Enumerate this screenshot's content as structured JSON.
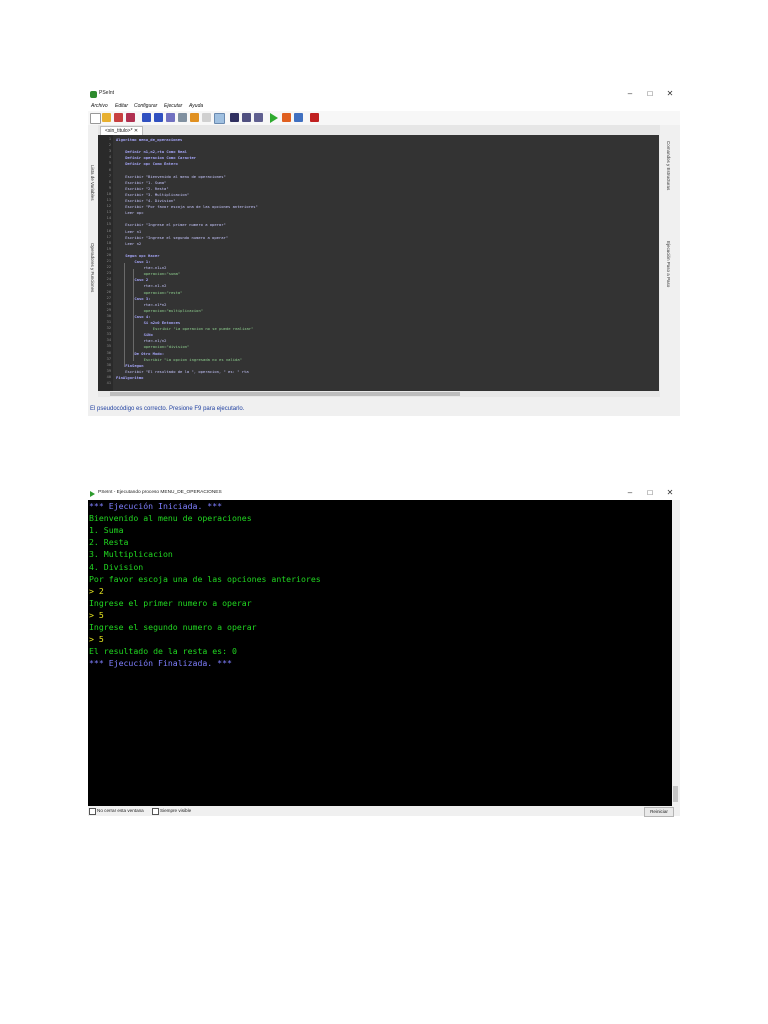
{
  "editor_window": {
    "title": "PSeInt",
    "controls": [
      "–",
      "□",
      "✕"
    ],
    "menu": [
      "Archivo",
      "Editar",
      "Configurar",
      "Ejecutar",
      "Ayuda"
    ],
    "left_panel_labels": [
      "Lista de Variables",
      "Operadores y Funciones"
    ],
    "right_panel_labels": [
      "Comandos y Estructuras",
      "Ejecución Paso a Paso"
    ],
    "tab_label": "<sin_titulo>*  ✕",
    "status": "El pseudocódigo es correcto. Presione F9 para ejecutarlo.",
    "accent_color": "#2e8b2e",
    "code_lines": [
      {
        "n": "1",
        "indent": 0,
        "type": "kw",
        "text": "Algoritmo menu_de_operaciones"
      },
      {
        "n": "2",
        "indent": 0,
        "type": "plain",
        "text": ""
      },
      {
        "n": "3",
        "indent": 2,
        "type": "kw",
        "text": "Definir n1,n2,rta Como Real"
      },
      {
        "n": "4",
        "indent": 2,
        "type": "kw",
        "text": "Definir operacion Como Caracter"
      },
      {
        "n": "5",
        "indent": 2,
        "type": "kw",
        "text": "Definir opc Como Entero"
      },
      {
        "n": "6",
        "indent": 0,
        "type": "plain",
        "text": ""
      },
      {
        "n": "7",
        "indent": 2,
        "type": "plain",
        "text": "Escribir \"Bienvenido al menu de operaciones\""
      },
      {
        "n": "8",
        "indent": 2,
        "type": "plain",
        "text": "Escribir \"1. Suma\""
      },
      {
        "n": "9",
        "indent": 2,
        "type": "plain",
        "text": "Escribir \"2. Resta\""
      },
      {
        "n": "10",
        "indent": 2,
        "type": "plain",
        "text": "Escribir \"3. Multiplicacion\""
      },
      {
        "n": "11",
        "indent": 2,
        "type": "plain",
        "text": "Escribir \"4. Division\""
      },
      {
        "n": "12",
        "indent": 2,
        "type": "plain",
        "text": "Escribir \"Por favor escoja una de las opciones anteriores\""
      },
      {
        "n": "13",
        "indent": 2,
        "type": "plain",
        "text": "Leer opc"
      },
      {
        "n": "14",
        "indent": 0,
        "type": "plain",
        "text": ""
      },
      {
        "n": "15",
        "indent": 2,
        "type": "plain",
        "text": "Escribir \"Ingrese el primer numero a operar\""
      },
      {
        "n": "16",
        "indent": 2,
        "type": "plain",
        "text": "Leer n1"
      },
      {
        "n": "17",
        "indent": 2,
        "type": "plain",
        "text": "Escribir \"Ingrese el segundo numero a operar\""
      },
      {
        "n": "18",
        "indent": 2,
        "type": "plain",
        "text": "Leer n2"
      },
      {
        "n": "19",
        "indent": 0,
        "type": "plain",
        "text": ""
      },
      {
        "n": "20",
        "indent": 2,
        "type": "kw",
        "text": "Segun opc Hacer"
      },
      {
        "n": "21",
        "indent": 4,
        "type": "kw",
        "text": "Caso 1:"
      },
      {
        "n": "22",
        "indent": 6,
        "type": "plain",
        "text": "rta<-n1+n2"
      },
      {
        "n": "23",
        "indent": 6,
        "type": "str",
        "text": "operacion=\"suma\""
      },
      {
        "n": "24",
        "indent": 4,
        "type": "kw",
        "text": "Caso 2"
      },
      {
        "n": "25",
        "indent": 6,
        "type": "plain",
        "text": "rta<-n1-n2"
      },
      {
        "n": "26",
        "indent": 6,
        "type": "str",
        "text": "operacion=\"resta\""
      },
      {
        "n": "27",
        "indent": 4,
        "type": "kw",
        "text": "Caso 3:"
      },
      {
        "n": "28",
        "indent": 6,
        "type": "plain",
        "text": "rta<-n1*n2"
      },
      {
        "n": "29",
        "indent": 6,
        "type": "str",
        "text": "operacion=\"multiplicacion\""
      },
      {
        "n": "30",
        "indent": 4,
        "type": "kw",
        "text": "Caso 4:"
      },
      {
        "n": "31",
        "indent": 6,
        "type": "kw",
        "text": "Si n2=0 Entonces"
      },
      {
        "n": "32",
        "indent": 8,
        "type": "str",
        "text": "Escribir \"La operacion no se puede realizar\""
      },
      {
        "n": "33",
        "indent": 6,
        "type": "kw",
        "text": "SiNo"
      },
      {
        "n": "34",
        "indent": 6,
        "type": "plain",
        "text": "rta<-n1/n2"
      },
      {
        "n": "35",
        "indent": 6,
        "type": "str",
        "text": "operacion=\"division\""
      },
      {
        "n": "36",
        "indent": 4,
        "type": "kw",
        "text": "De Otro Modo:"
      },
      {
        "n": "37",
        "indent": 6,
        "type": "str",
        "text": "Escribir \"La opcion ingresada no es valida\""
      },
      {
        "n": "38",
        "indent": 2,
        "type": "kw",
        "text": "FinSegun"
      },
      {
        "n": "39",
        "indent": 2,
        "type": "plain",
        "text": "Escribir \"El resultado de la \", operacion, \" es: \" rta"
      },
      {
        "n": "40",
        "indent": 0,
        "type": "kw",
        "text": "FinAlgoritmo"
      },
      {
        "n": "41",
        "indent": 0,
        "type": "plain",
        "text": ""
      }
    ]
  },
  "console_window": {
    "title": "PSeInt - Ejecutando proceso MENU_DE_OPERACIONES",
    "controls": [
      "–",
      "□",
      "✕"
    ],
    "lines": [
      {
        "text": "*** Ejecución Iniciada. ***",
        "color": "#7f7fff"
      },
      {
        "text": "Bienvenido al menu de operaciones",
        "color": "#21d621"
      },
      {
        "text": "1. Suma",
        "color": "#21d621"
      },
      {
        "text": "2. Resta",
        "color": "#21d621"
      },
      {
        "text": "3. Multiplicacion",
        "color": "#21d621"
      },
      {
        "text": "4. Division",
        "color": "#21d621"
      },
      {
        "text": "Por favor escoja una de las opciones anteriores",
        "color": "#21d621"
      },
      {
        "text": "> 2",
        "color": "#e8e820"
      },
      {
        "text": "Ingrese el primer numero a operar",
        "color": "#21d621"
      },
      {
        "text": "> 5",
        "color": "#e8e820"
      },
      {
        "text": "Ingrese el segundo numero a operar",
        "color": "#21d621"
      },
      {
        "text": "> 5",
        "color": "#e8e820"
      },
      {
        "text": "El resultado de la resta es: 0",
        "color": "#21d621"
      },
      {
        "text": "*** Ejecución Finalizada. ***",
        "color": "#7f7fff"
      }
    ],
    "checkbox_no_cerrar": "No cerrar esta ventana",
    "checkbox_siempre_visible": "Siempre visible",
    "reiniciar_label": "Reiniciar"
  }
}
